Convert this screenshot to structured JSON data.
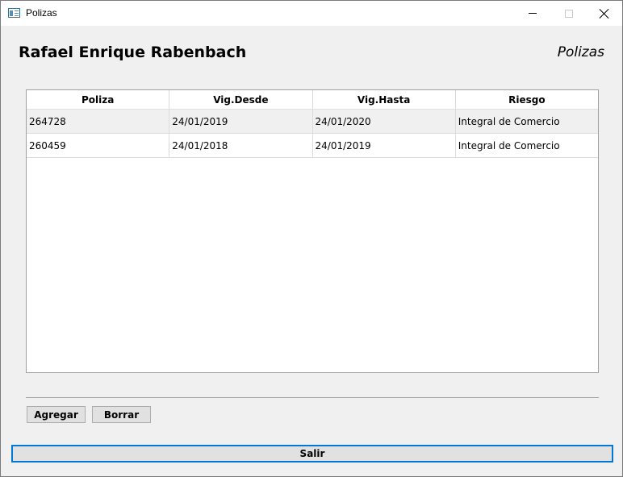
{
  "window": {
    "title": "Polizas"
  },
  "header": {
    "client_name": "Rafael Enrique Rabenbach",
    "form_title": "Polizas"
  },
  "table": {
    "columns": [
      "Poliza",
      "Vig.Desde",
      "Vig.Hasta",
      "Riesgo"
    ],
    "rows": [
      [
        "264728",
        "24/01/2019",
        "24/01/2020",
        "Integral de Comercio"
      ],
      [
        "260459",
        "24/01/2018",
        "24/01/2019",
        "Integral de Comercio"
      ]
    ]
  },
  "buttons": {
    "add_label": "Agregar",
    "delete_label": "Borrar",
    "exit_label": "Salir"
  },
  "colors": {
    "focus_border": "#0078d7",
    "row_alt": "#f0f0f0"
  },
  "icons": {
    "app": "window-app-icon",
    "minimize": "minimize-icon",
    "maximize": "maximize-icon",
    "close": "close-icon"
  }
}
